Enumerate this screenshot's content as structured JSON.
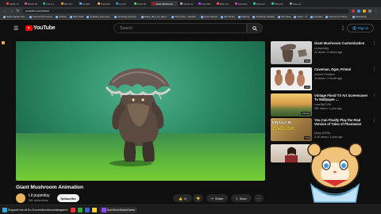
{
  "browser": {
    "tabs": [
      {
        "label": "Sprite Gr",
        "color": "#e44"
      },
      {
        "label": "Bored Dc",
        "color": "#c5a"
      },
      {
        "label": "List of s",
        "color": "#3a7"
      },
      {
        "label": "Bill Ost",
        "color": "#e93"
      },
      {
        "label": "Doodle",
        "color": "#4af"
      },
      {
        "label": "Pumpkin",
        "color": "#fa3"
      },
      {
        "label": "Lymph",
        "color": "#39c"
      },
      {
        "label": "Shell Sh",
        "color": "#6c6"
      },
      {
        "label": "Giant Mushroom",
        "color": "#f00",
        "active": true
      },
      {
        "label": "Visual Sc",
        "color": "#aaa"
      },
      {
        "label": "Animatic",
        "color": "#a4f"
      },
      {
        "label": "Best mo",
        "color": "#f55"
      },
      {
        "label": "Animatic",
        "color": "#c4a"
      },
      {
        "label": "Phonem",
        "color": "#3c9"
      },
      {
        "label": "Phonem",
        "color": "#3c9"
      },
      {
        "label": "elise eu",
        "color": "#999"
      }
    ],
    "url": "youtube.com/watch",
    "bookmarks": [
      "Sprite Dealer Mo...",
      "Transmit.IO Issues",
      "Archive",
      "Nico Staff",
      "Software and lines...",
      "Sprucing and tips...",
      "Daisy_Bee_by_Mem...",
      "Fluent Pen - Randa...",
      "Good Stories",
      "UIX Notes",
      "Sharing",
      "Character Models",
      "UIX Style",
      "Oliver - K",
      "Animatic",
      "Licence to Thrive...",
      "Photoshop"
    ]
  },
  "youtube": {
    "logo_text": "YouTube",
    "search_placeholder": "Search",
    "signin_label": "Sign in",
    "video": {
      "title": "Giant Mushroom Animation",
      "channel": "Lil pupinduy",
      "subscribers": "351 subscribers",
      "subscribe_label": "Subscribe",
      "likes": "6",
      "share_label": "Share",
      "save_label": "Save"
    },
    "recommendations": [
      {
        "title": "Giant Mushroom Customization",
        "channel": "Lil pupinduy",
        "meta": "41 views • 3 weeks ago",
        "duration": "0:34",
        "thumb": "mushroom"
      },
      {
        "title": "Caveman, Ogre, Primal",
        "channel": "Andrew Ermakov",
        "meta": "26 views • 1 month ago",
        "duration": "1:11",
        "thumb": "ogre"
      },
      {
        "title": "Vintage Flood TV Art Screensaver Tv Wallpaper ...",
        "channel": "LuxeSkyTV4K",
        "meta": "55K views • 1 year ago",
        "duration": "2:00:00",
        "thumb": "landscape"
      },
      {
        "title": "You Can Finally Play the Real Version of Tales of Phantasia!",
        "channel": "Dinky JRPGs",
        "meta": "3.4K views • 1 year ago",
        "duration": "7:04",
        "thumb": "tales"
      },
      {
        "title": "",
        "channel": "",
        "meta": "",
        "duration": "",
        "thumb": "person"
      }
    ],
    "thumb_texts": {
      "tales_top": "FINALLY IN",
      "tales_bottom": "ENGLISH"
    }
  },
  "taskbar": {
    "items": [
      {
        "label": "Support me at Ko-fi.com/dumdummakegame",
        "color": "#29abe0"
      },
      {
        "label": "",
        "color": "#e33"
      },
      {
        "label": "",
        "color": "#3a3"
      },
      {
        "label": "",
        "color": "#36c"
      },
      {
        "label": "",
        "color": "#fc3"
      },
      {
        "label": "DumDumMakeGame",
        "color": "#9146ff",
        "active": true
      }
    ]
  },
  "colors": {
    "accent": "#ff0000",
    "link": "#3ea6ff",
    "bg": "#0f0f0f"
  }
}
